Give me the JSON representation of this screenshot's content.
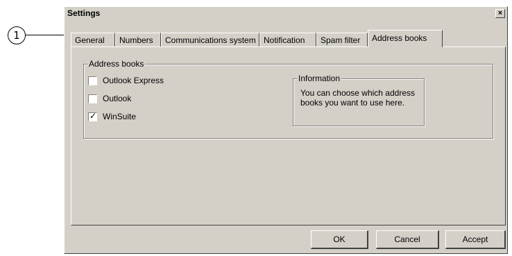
{
  "callout": {
    "number": "1"
  },
  "window": {
    "title": "Settings",
    "close_glyph": "×"
  },
  "tabs": [
    {
      "label": "General"
    },
    {
      "label": "Numbers"
    },
    {
      "label": "Communications system"
    },
    {
      "label": "Notification"
    },
    {
      "label": "Spam filter"
    },
    {
      "label": "Address books",
      "active": true
    }
  ],
  "address_books_group": {
    "legend": "Address books",
    "items": [
      {
        "label": "Outlook Express",
        "checked": false
      },
      {
        "label": "Outlook",
        "checked": false
      },
      {
        "label": "WinSuite",
        "checked": true,
        "checkmark": "✓"
      }
    ]
  },
  "information_group": {
    "legend": "Information",
    "text": "You can choose which address books you want to use here."
  },
  "buttons": {
    "ok": "OK",
    "cancel": "Cancel",
    "accept": "Accept"
  }
}
